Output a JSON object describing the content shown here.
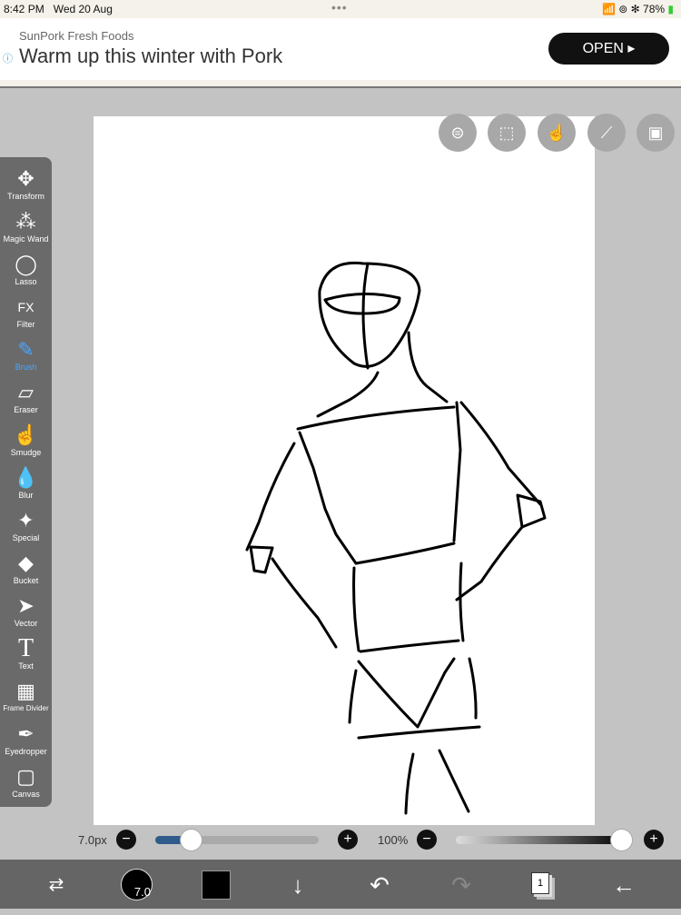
{
  "status": {
    "time": "8:42 PM",
    "date": "Wed 20 Aug",
    "battery": "78%"
  },
  "ad": {
    "brand": "SunPork Fresh Foods",
    "headline": "Warm up this winter with Pork",
    "cta": "OPEN ▸"
  },
  "tools": [
    {
      "label": "Transform",
      "icon": "✥"
    },
    {
      "label": "Magic Wand",
      "icon": "⁂"
    },
    {
      "label": "Lasso",
      "icon": "◯"
    },
    {
      "label": "Filter",
      "icon": "FX"
    },
    {
      "label": "Brush",
      "icon": "✎"
    },
    {
      "label": "Eraser",
      "icon": "▱"
    },
    {
      "label": "Smudge",
      "icon": "☝"
    },
    {
      "label": "Blur",
      "icon": "💧"
    },
    {
      "label": "Special",
      "icon": "✦"
    },
    {
      "label": "Bucket",
      "icon": "◆"
    },
    {
      "label": "Vector",
      "icon": "➤"
    },
    {
      "label": "Text",
      "icon": "T"
    },
    {
      "label": "Frame Divider",
      "icon": "▦"
    },
    {
      "label": "Eyedropper",
      "icon": "✒"
    },
    {
      "label": "Canvas",
      "icon": "▢"
    }
  ],
  "active_tool": "Brush",
  "brush": {
    "size_label": "7.0px",
    "size_fraction": 0.13,
    "opacity_label": "100%",
    "opacity_fraction": 1.0,
    "size_badge": "7.0"
  },
  "layers": {
    "count": "1"
  },
  "colors": {
    "current": "#000000"
  }
}
